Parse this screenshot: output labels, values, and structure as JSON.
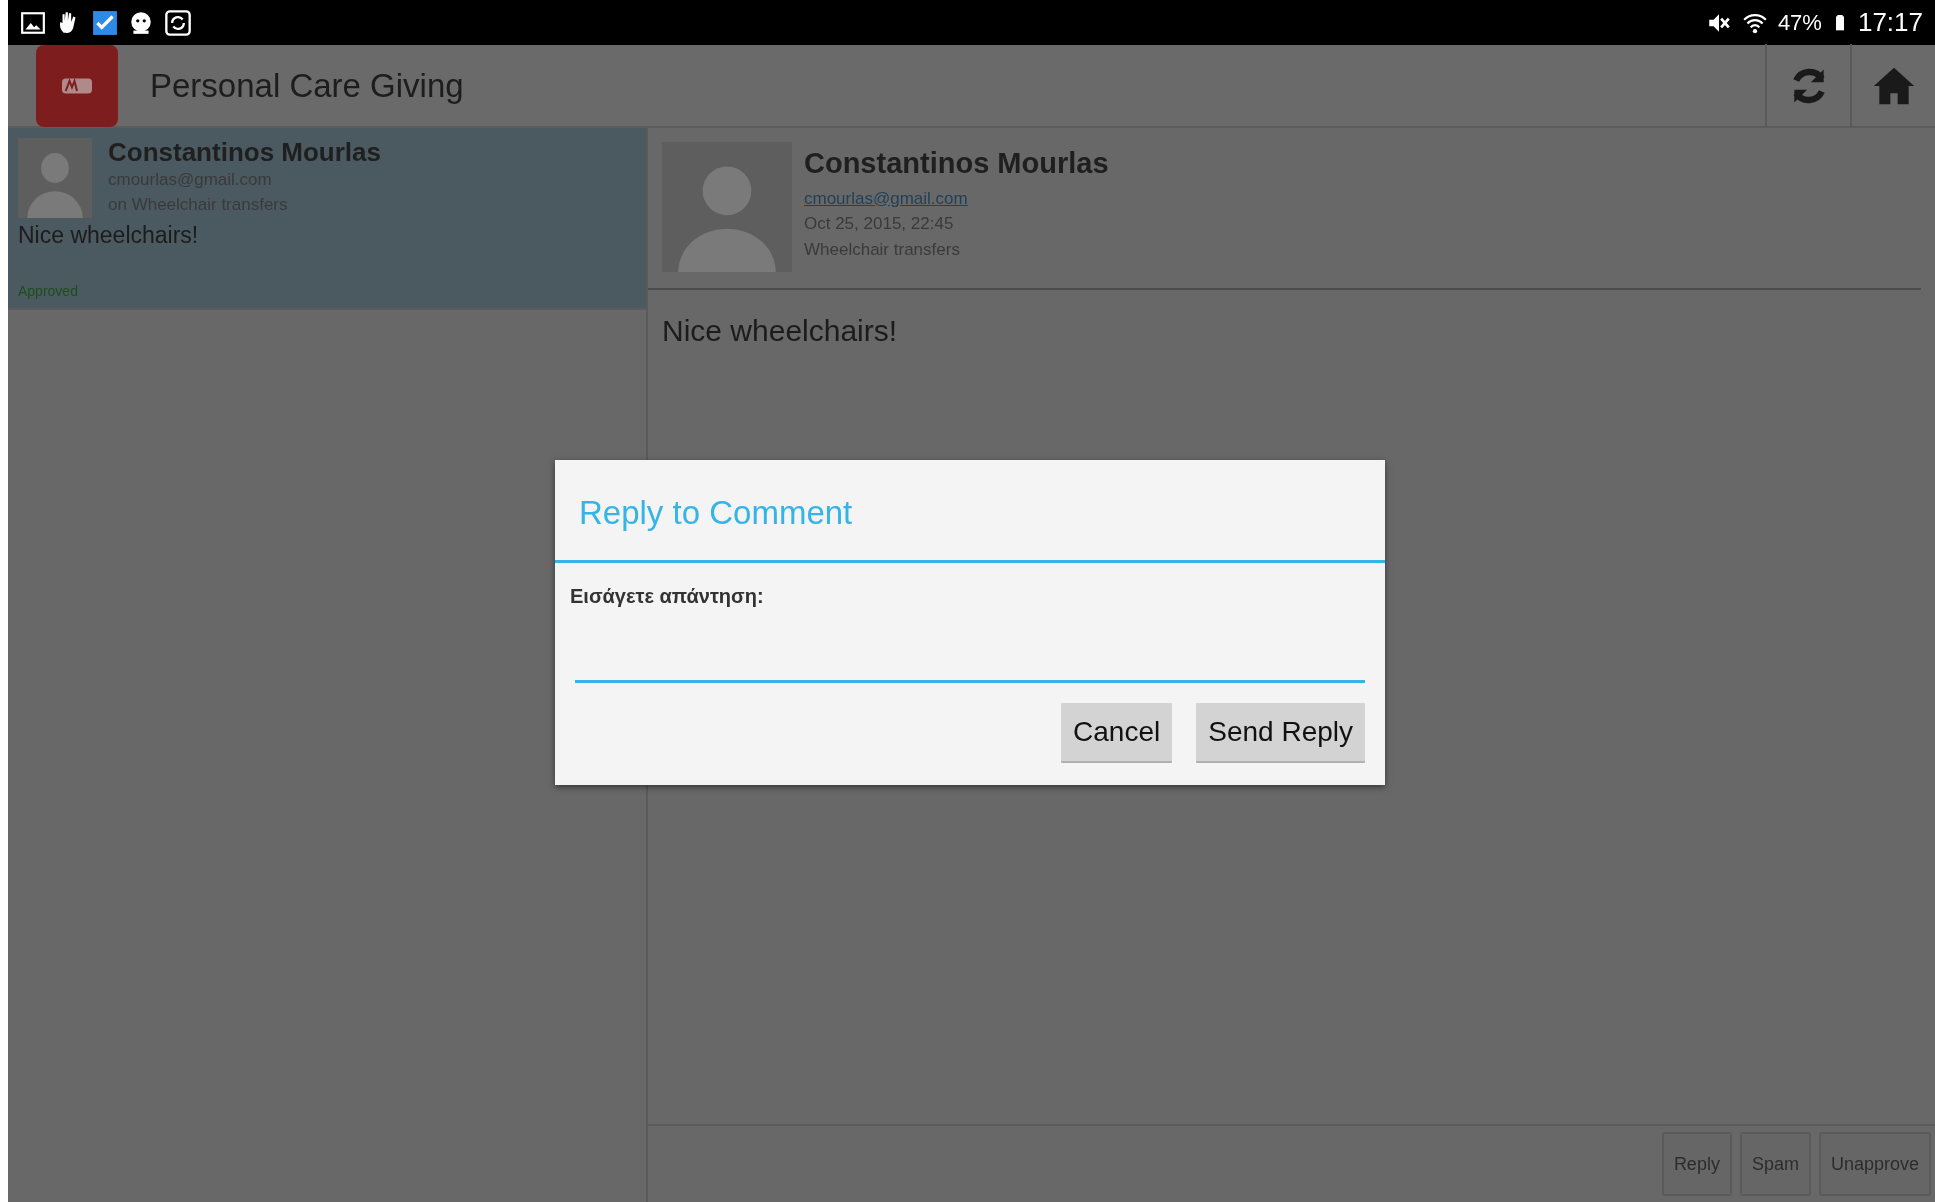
{
  "status_bar": {
    "battery": "47%",
    "time": "17:17"
  },
  "app_bar": {
    "title": "Personal Care Giving"
  },
  "comments": [
    {
      "name": "Constantinos Mourlas",
      "email": "cmourlas@gmail.com",
      "post": "on Wheelchair transfers",
      "text": "Nice wheelchairs!",
      "status": "Approved",
      "selected": true
    }
  ],
  "detail": {
    "name": "Constantinos Mourlas",
    "email": "cmourlas@gmail.com",
    "date": "Oct 25, 2015, 22:45",
    "post": "Wheelchair transfers",
    "text": "Nice wheelchairs!",
    "actions": [
      "Reply",
      "Spam",
      "Unapprove"
    ]
  },
  "dialog": {
    "title": "Reply to Comment",
    "label": "Εισάγετε απάντηση:",
    "buttons": [
      "Cancel",
      "Send Reply"
    ]
  }
}
